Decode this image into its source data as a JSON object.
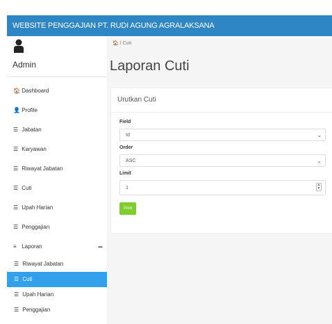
{
  "topbar": {
    "brand_left": "WEBSITE PENGGAJIAN ",
    "brand_right": "PT. RUDI AGUNG AGRALAKSANA"
  },
  "user": {
    "name": "Admin"
  },
  "sidebar": {
    "items": [
      {
        "icon": "🏠",
        "label": "Dashboard"
      },
      {
        "icon": "👤",
        "label": "Profile"
      },
      {
        "icon": "☰",
        "label": "Jabatan"
      },
      {
        "icon": "☰",
        "label": "Karyawan"
      },
      {
        "icon": "☰",
        "label": "Riwayat Jabatan"
      },
      {
        "icon": "☰",
        "label": "Cuti"
      },
      {
        "icon": "☰",
        "label": "Upah Harian"
      },
      {
        "icon": "☰",
        "label": "Penggajian"
      },
      {
        "icon": "≡",
        "label": "Laporan",
        "collapse": "−"
      }
    ],
    "submenu": [
      {
        "icon": "☰",
        "label": "Riwayat Jabatan"
      },
      {
        "icon": "☰",
        "label": "Cuti",
        "active": true
      },
      {
        "icon": "☰",
        "label": "Upah Harian"
      },
      {
        "icon": "☰",
        "label": "Penggajian"
      }
    ]
  },
  "breadcrumb": {
    "home_icon": "🏠",
    "separator": "/",
    "current": "Cuti"
  },
  "page": {
    "title": "Laporan Cuti"
  },
  "panel": {
    "heading": "Urutkan Cuti",
    "field_label": "Field",
    "field_value": "Id",
    "order_label": "Order",
    "order_value": "ASC",
    "limit_label": "Limit",
    "limit_value": "1",
    "print_label": "Print"
  },
  "colors": {
    "topbar": "#2f86c5",
    "active": "#33a0ec",
    "print": "#7fcd2d"
  }
}
